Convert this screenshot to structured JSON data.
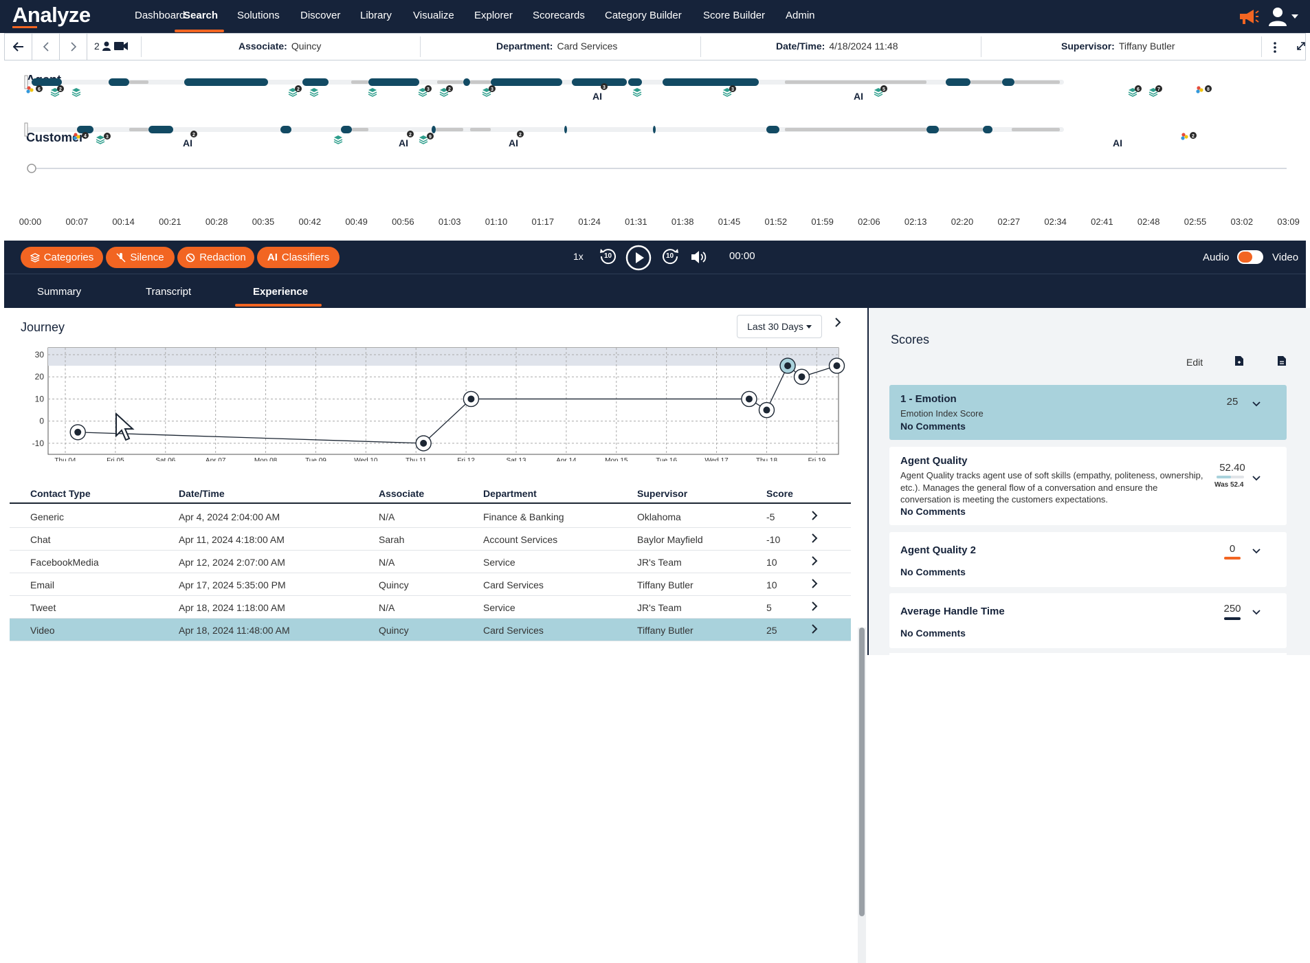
{
  "app": {
    "logo": "Analyze",
    "nav": [
      "Dashboard",
      "Search",
      "Solutions",
      "Discover",
      "Library",
      "Visualize",
      "Explorer",
      "Scorecards",
      "Category Builder",
      "Score Builder",
      "Admin"
    ],
    "active_nav": "Search"
  },
  "subbar": {
    "count": "2",
    "associate_label": "Associate:",
    "associate": "Quincy",
    "department_label": "Department:",
    "department": "Card Services",
    "datetime_label": "Date/Time:",
    "datetime": "4/18/2024 11:48",
    "supervisor_label": "Supervisor:",
    "supervisor": "Tiffany Butler"
  },
  "timeline": {
    "agent_label": "Agent",
    "customer_label": "Customer",
    "ticks": [
      "00:00",
      "00:07",
      "00:14",
      "00:21",
      "00:28",
      "00:35",
      "00:42",
      "00:49",
      "00:56",
      "01:03",
      "01:10",
      "01:17",
      "01:24",
      "01:31",
      "01:38",
      "01:45",
      "01:52",
      "01:59",
      "02:06",
      "02:13",
      "02:20",
      "02:27",
      "02:34",
      "02:41",
      "02:48",
      "02:55",
      "03:02",
      "03:09"
    ],
    "ai_label": "AI",
    "agent_badges": [
      "6",
      "2",
      "2",
      "3",
      "2",
      "3",
      "3",
      "3",
      "5",
      "6",
      "7",
      "8"
    ],
    "customer_badges": [
      "4",
      "3",
      "2",
      "2",
      "9",
      "2",
      "2"
    ]
  },
  "controls": {
    "categories": "Categories",
    "silence": "Silence",
    "redaction": "Redaction",
    "ai_prefix": "AI",
    "classifiers": "Classifiers",
    "speed": "1x",
    "skip": "10",
    "time": "00:00",
    "audio": "Audio",
    "video": "Video"
  },
  "tabs": [
    "Summary",
    "Transcript",
    "Experience"
  ],
  "active_tab": "Experience",
  "journey": {
    "title": "Journey",
    "range": "Last 30 Days",
    "chart_data": {
      "type": "line",
      "x_labels": [
        "Thu 04",
        "Fri 05",
        "Sat 06",
        "Apr 07",
        "Mon 08",
        "Tue 09",
        "Wed 10",
        "Thu 11",
        "Fri 12",
        "Sat 13",
        "Apr 14",
        "Mon 15",
        "Tue 16",
        "Wed 17",
        "Thu 18",
        "Fri 19"
      ],
      "yticks": [
        30,
        20,
        10,
        0,
        -10
      ],
      "ylim": [
        -15,
        30
      ],
      "points": [
        {
          "x": 0.25,
          "y": -5,
          "channel": "document-icon"
        },
        {
          "x": 7.15,
          "y": -10,
          "channel": "chat-icon"
        },
        {
          "x": 8.1,
          "y": 10,
          "channel": "facebook-icon"
        },
        {
          "x": 13.65,
          "y": 10,
          "channel": "email-icon"
        },
        {
          "x": 14.0,
          "y": 5,
          "channel": "twitter-icon"
        },
        {
          "x": 14.42,
          "y": 25,
          "channel": "video-icon"
        },
        {
          "x": 14.7,
          "y": 20,
          "channel": "phone-icon"
        },
        {
          "x": 15.4,
          "y": 25,
          "channel": "clipboard-icon"
        }
      ]
    }
  },
  "table": {
    "headers": [
      "Contact Type",
      "Date/Time",
      "Associate",
      "Department",
      "Supervisor",
      "Score"
    ],
    "rows": [
      [
        "Generic",
        "Apr 4, 2024 2:04:00 AM",
        "N/A",
        "Finance & Banking",
        "Oklahoma",
        "-5"
      ],
      [
        "Chat",
        "Apr 11, 2024 4:18:00 AM",
        "Sarah",
        "Account Services",
        "Baylor Mayfield",
        "-10"
      ],
      [
        "FacebookMedia",
        "Apr 12, 2024 2:07:00 AM",
        "N/A",
        "Service",
        "JR's Team",
        "10"
      ],
      [
        "Email",
        "Apr 17, 2024 5:35:00 PM",
        "Quincy",
        "Card Services",
        "Tiffany Butler",
        "10"
      ],
      [
        "Tweet",
        "Apr 18, 2024 1:18:00 AM",
        "N/A",
        "Service",
        "JR's Team",
        "5"
      ],
      [
        "Video",
        "Apr 18, 2024 11:48:00 AM",
        "Quincy",
        "Card Services",
        "Tiffany Butler",
        "25"
      ]
    ],
    "selected_index": 5
  },
  "scores": {
    "title": "Scores",
    "edit": "Edit",
    "cards": [
      {
        "title": "1 - Emotion",
        "subtitle": "Emotion Index Score",
        "comments": "No Comments",
        "value": "25"
      },
      {
        "title": "Agent Quality",
        "description": "Agent Quality tracks agent use of soft skills (empathy, politeness, ownership, etc.). Manages the general flow of a conversation and ensure the conversation is meeting the customers expectations.",
        "comments": "No Comments",
        "value": "52.40",
        "was": "Was 52.4",
        "bar_color": "#a9d2dc",
        "bar_fraction": 0.52
      },
      {
        "title": "Agent Quality 2",
        "comments": "No Comments",
        "value": "0",
        "bar_color": "#f26522"
      },
      {
        "title": "Average Handle Time",
        "comments": "No Comments",
        "value": "250",
        "bar_color": "#16233a"
      }
    ]
  },
  "colors": {
    "navy": "#16233a",
    "orange": "#f26522",
    "teal_dark": "#124a63",
    "highlight": "#a9d2dc",
    "teal_icon": "#2e9e8c"
  }
}
